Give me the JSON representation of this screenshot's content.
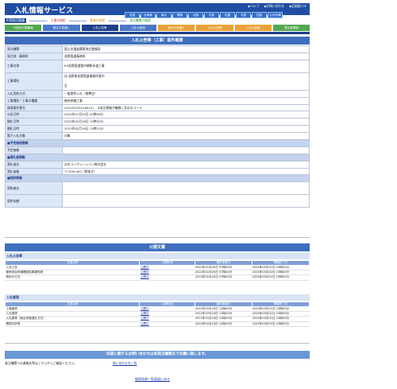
{
  "header": {
    "logo": "入札情報サービス",
    "toplinks": [
      "◆ヘルプ",
      "◆お問い合わせ",
      "◆全国版TOP"
    ],
    "regions": [
      "全国",
      "北海道",
      "東北",
      "関東",
      "北陸",
      "中部",
      "近畿",
      "中国",
      "四国",
      "九州沖縄"
    ]
  },
  "categories": [
    "中国地方整備",
    "************",
    "工事の検索",
    "************",
    "業務の検索",
    "************",
    "発注機関の検索"
  ],
  "navtabs": [
    "中国地方整備局",
    "発注の見通し",
    "入札公告等",
    "入札の経過",
    "発注の見通し",
    "入札公告等",
    "入札の経過",
    "発注者情報"
  ],
  "detail": {
    "title": "入札公告等（工事）案件概要",
    "rows": [
      {
        "k": "発注機関",
        "v": "国土交通省関東地方整備局"
      },
      {
        "k": "発注部・事務所",
        "v": "長野国道事務所"
      },
      {
        "k": "工事名称",
        "v": "R3長野国道管内横断歩道工事"
      },
      {
        "k": "工事場所",
        "v": "自 長野県長野国道事務所管内",
        "v2": "至"
      },
      {
        "k": "入札契約方式",
        "v": "一般競争入札（標準型）"
      },
      {
        "k": "工事種別／工事の種類",
        "v": "維持修繕工事"
      },
      {
        "k": "調達案件番号",
        "v": "2021037001(6915)",
        "note": "※発注情報が複数に及めるコード"
      },
      {
        "k": "公告日時",
        "v": "2022年01月05日 00時00分"
      },
      {
        "k": "開札日時",
        "v": "2022年02月16日 15時00分"
      },
      {
        "k": "開札日時",
        "v": "2022年02月16日 15時01分"
      },
      {
        "k": "電子入札対象",
        "v": "対象"
      }
    ],
    "group_plan": "■予定価格情報",
    "plan_rows": [
      {
        "k": "予定価格",
        "v": ""
      }
    ],
    "group_award": "■落札者情報",
    "award_rows": [
      {
        "k": "落札者名",
        "v": "水矢コーポレーション株式会社"
      },
      {
        "k": "落札価格",
        "v": "77,900,000（税抜き）"
      }
    ],
    "group_contract": "■契約情報",
    "contract_rows": [
      {
        "k": "契約者名",
        "v": ""
      },
      {
        "k": "契約金額",
        "v": ""
      }
    ]
  },
  "docs": {
    "title": "公開文書",
    "headers": [
      "文書名称",
      "公開状況",
      "最終更新日",
      "掲載終了日"
    ],
    "groups": [
      {
        "title": "入札公告等",
        "rows": [
          [
            "入札公告",
            "公開中",
            "2022年01月05日 07時00分",
            "2024年03月31日 23時00分"
          ],
          [
            "競争参加資格確認結果通知書",
            "公開中",
            "2022年01月05日 07時00分",
            "2024年03月31日 23時00分"
          ],
          [
            "契約の方法",
            "公開中",
            "2022年01月25日 07時00分",
            "2024年03月31日 23時00分"
          ]
        ]
      },
      {
        "title": "入札経過",
        "rows": [
          [
            "工事調書",
            "公開中",
            "2022年02月24日 12時00分",
            "2024年03月31日 23時00分"
          ],
          [
            "入札調書",
            "公開中",
            "2022年02月24日 12時00分",
            "2024年03月31日 23時00分"
          ],
          [
            "入札調書（総合評価落札方式）",
            "公開中",
            "2022年02月24日 12時00分",
            "2024年03月31日 23時00分"
          ],
          [
            "積算内訳書",
            "公開中",
            "2022年02月24日 12時00分",
            "2024年03月31日 23時00分"
          ]
        ]
      }
    ]
  },
  "contact": {
    "bar": "内容に関するお問い合わせは各発注機関までお願い致します。",
    "label": "発注機関への連絡先等はこちらからご確認ください。",
    "link": "問い合わせ先一覧"
  },
  "back_link": "検索結果一覧画面に戻る"
}
